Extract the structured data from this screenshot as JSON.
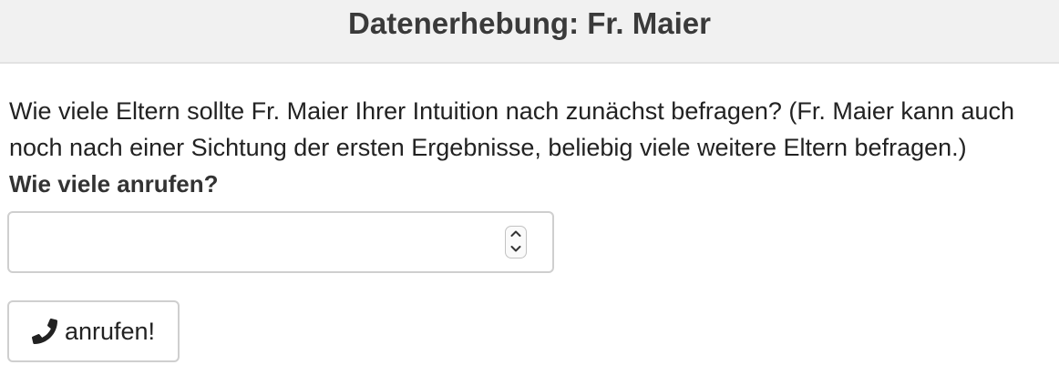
{
  "header": {
    "title": "Datenerhebung: Fr. Maier"
  },
  "question": {
    "line1": "Wie viele Eltern sollte Fr. Maier Ihrer Intuition nach zunächst befragen? (Fr. Maier kann auch",
    "line2": "noch nach einer Sichtung der ersten Ergebnisse, beliebig viele weitere Eltern befragen.)"
  },
  "field": {
    "label": "Wie viele anrufen?",
    "value": "",
    "placeholder": ""
  },
  "button": {
    "label": "anrufen!",
    "icon": "phone-icon"
  }
}
